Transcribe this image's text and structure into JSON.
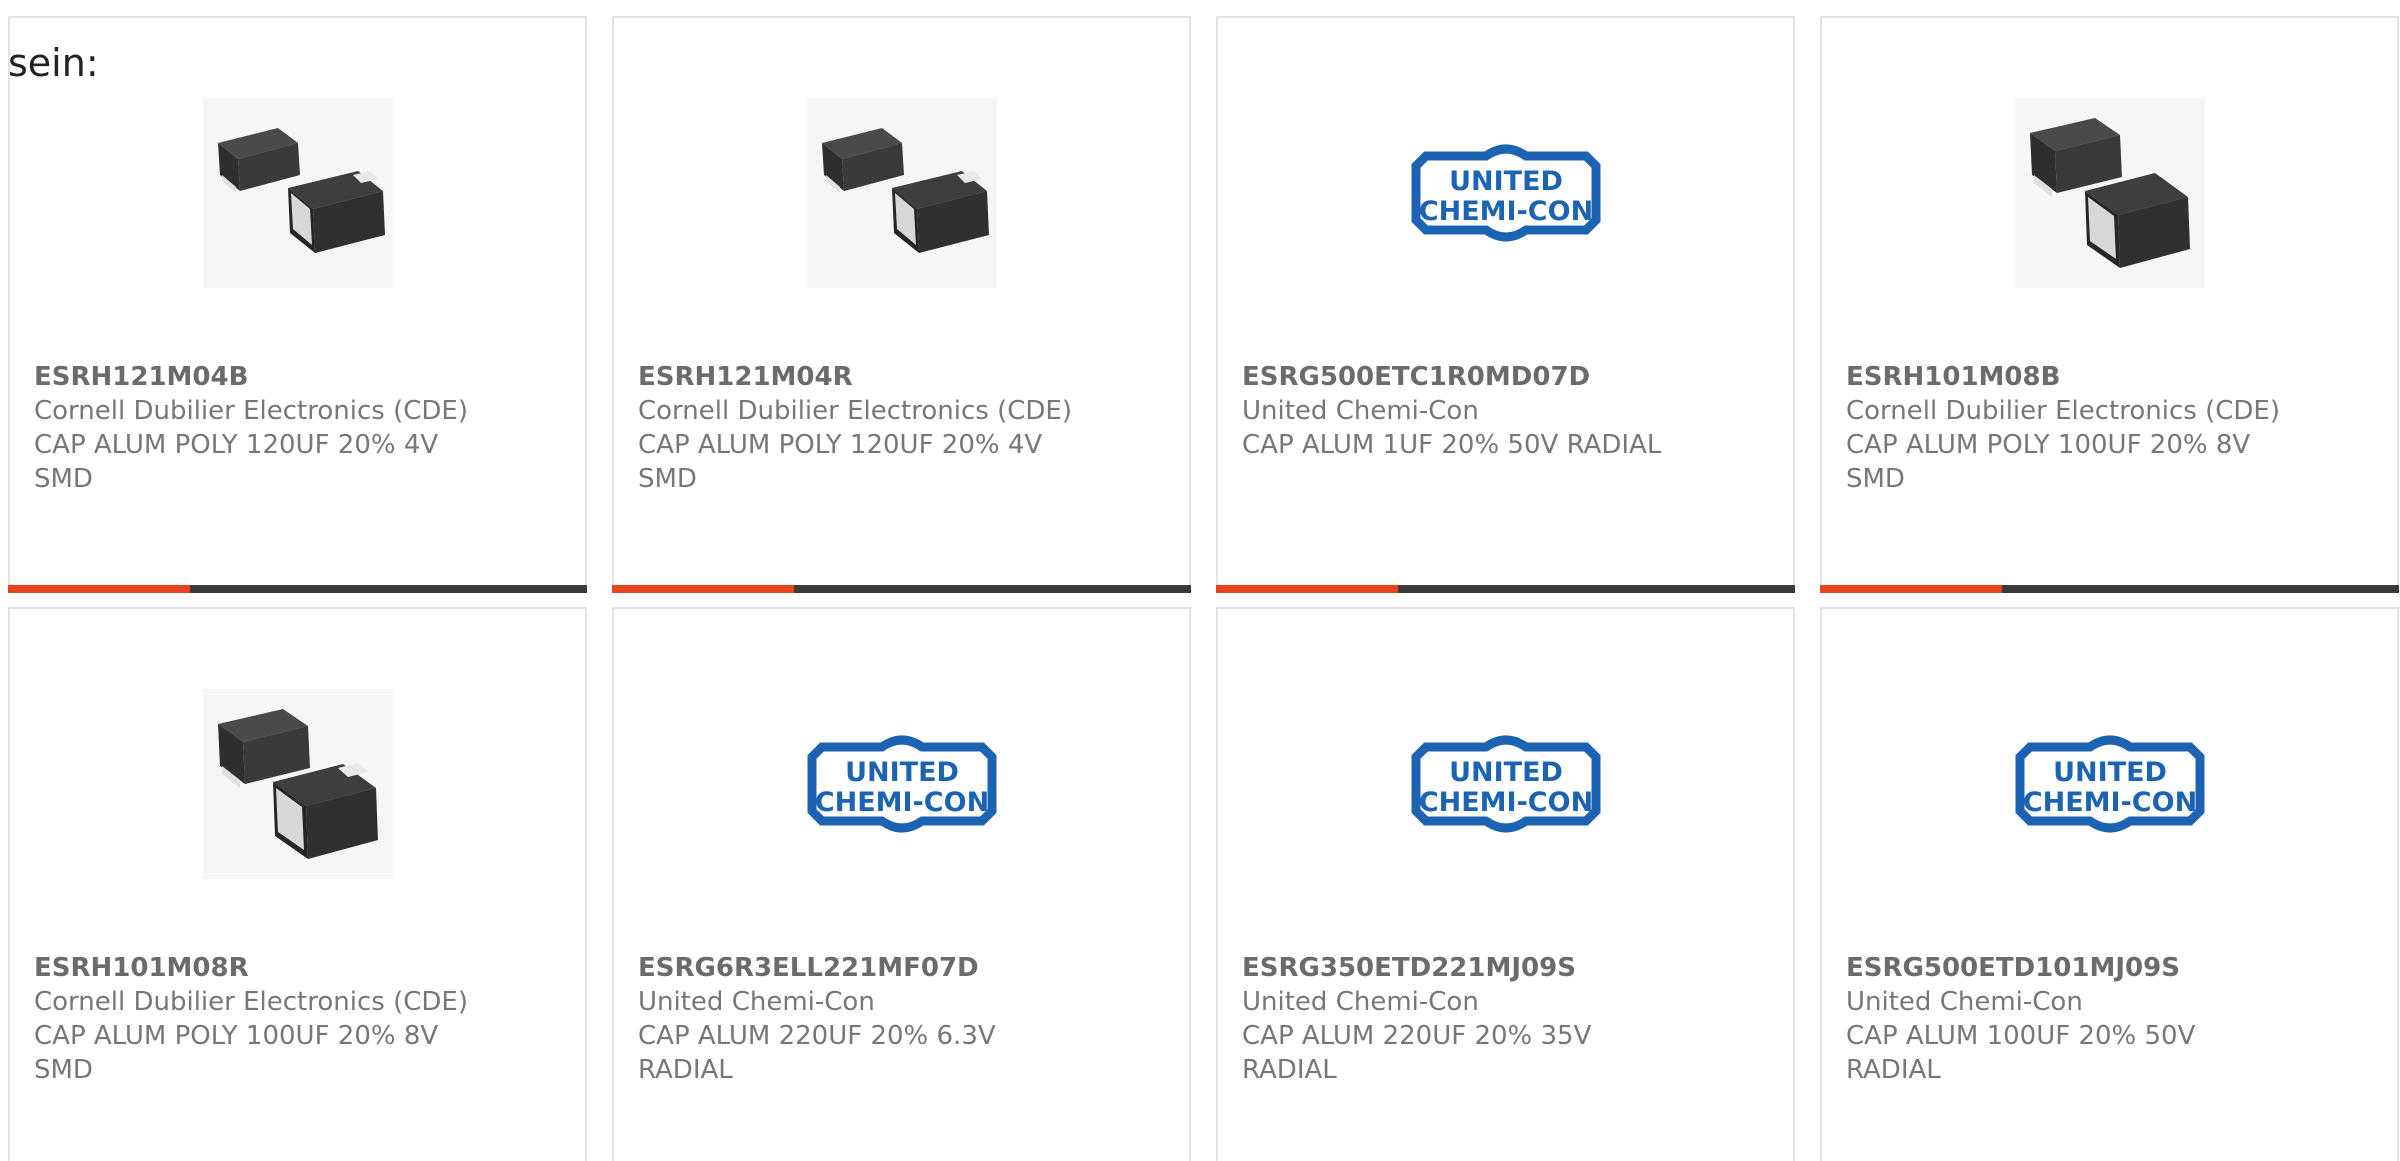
{
  "intro_text": "sein:",
  "colors": {
    "accent": "#e8431c",
    "bar": "#3a3a3a",
    "logo_blue": "#1c64b3"
  },
  "products": [
    {
      "part_number": "ESRH121M04B",
      "manufacturer": "Cornell Dubilier Electronics (CDE)",
      "description": "CAP ALUM POLY 120UF 20% 4V SMD",
      "image": "smd-capacitor-image",
      "logo_text": {
        "line1": "",
        "line2": ""
      }
    },
    {
      "part_number": "ESRH121M04R",
      "manufacturer": "Cornell Dubilier Electronics (CDE)",
      "description": "CAP ALUM POLY 120UF 20% 4V SMD",
      "image": "smd-capacitor-image",
      "logo_text": {
        "line1": "",
        "line2": ""
      }
    },
    {
      "part_number": "ESRG500ETC1R0MD07D",
      "manufacturer": "United Chemi-Con",
      "description": "CAP ALUM 1UF 20% 50V RADIAL",
      "image": "united-chemi-con-logo",
      "logo_text": {
        "line1": "UNITED",
        "line2": "CHEMI-CON"
      }
    },
    {
      "part_number": "ESRH101M08B",
      "manufacturer": "Cornell Dubilier Electronics (CDE)",
      "description": "CAP ALUM POLY 100UF 20% 8V SMD",
      "image": "smd-capacitor-image",
      "logo_text": {
        "line1": "",
        "line2": ""
      }
    },
    {
      "part_number": "ESRH101M08R",
      "manufacturer": "Cornell Dubilier Electronics (CDE)",
      "description": "CAP ALUM POLY 100UF 20% 8V SMD",
      "image": "smd-capacitor-image",
      "logo_text": {
        "line1": "",
        "line2": ""
      }
    },
    {
      "part_number": "ESRG6R3ELL221MF07D",
      "manufacturer": "United Chemi-Con",
      "description": "CAP ALUM 220UF 20% 6.3V RADIAL",
      "image": "united-chemi-con-logo",
      "logo_text": {
        "line1": "UNITED",
        "line2": "CHEMI-CON"
      }
    },
    {
      "part_number": "ESRG350ETD221MJ09S",
      "manufacturer": "United Chemi-Con",
      "description": "CAP ALUM 220UF 20% 35V RADIAL",
      "image": "united-chemi-con-logo",
      "logo_text": {
        "line1": "UNITED",
        "line2": "CHEMI-CON"
      }
    },
    {
      "part_number": "ESRG500ETD101MJ09S",
      "manufacturer": "United Chemi-Con",
      "description": "CAP ALUM 100UF 20% 50V RADIAL",
      "image": "united-chemi-con-logo",
      "logo_text": {
        "line1": "UNITED",
        "line2": "CHEMI-CON"
      }
    }
  ]
}
